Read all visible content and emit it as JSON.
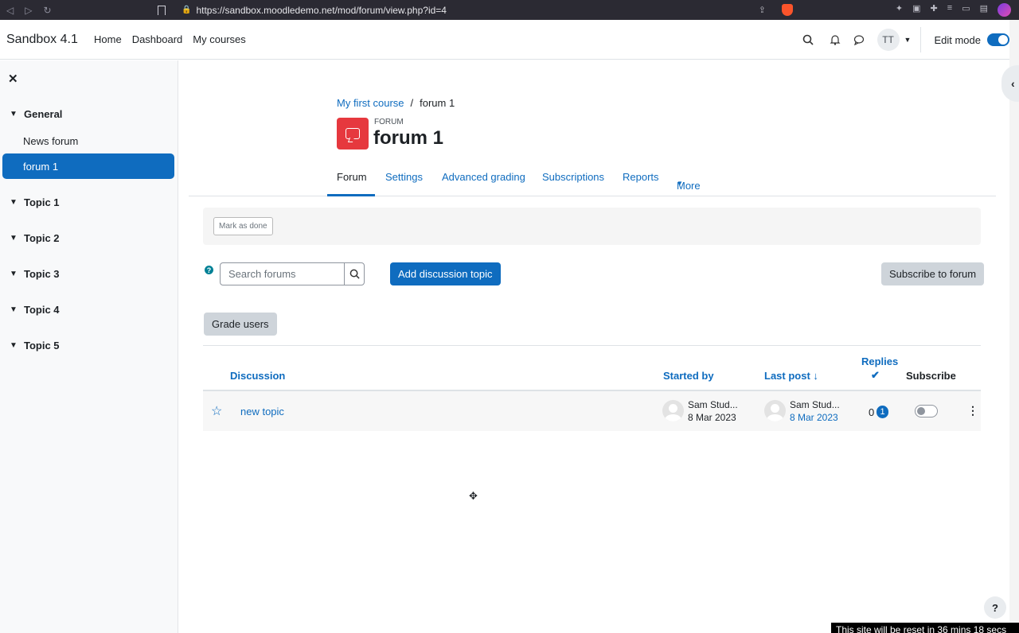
{
  "browser": {
    "url": "https://sandbox.moodledemo.net/mod/forum/view.php?id=4"
  },
  "navbar": {
    "brand": "Sandbox 4.1",
    "links": [
      "Home",
      "Dashboard",
      "My courses"
    ],
    "user_initials": "TT",
    "edit_mode_label": "Edit mode",
    "edit_mode_on": true
  },
  "drawer": {
    "sections": [
      {
        "label": "General",
        "activities": [
          "News forum",
          "forum 1"
        ]
      },
      {
        "label": "Topic 1"
      },
      {
        "label": "Topic 2"
      },
      {
        "label": "Topic 3"
      },
      {
        "label": "Topic 4"
      },
      {
        "label": "Topic 5"
      }
    ],
    "active_activity": "forum 1"
  },
  "breadcrumb": {
    "course": "My first course",
    "separator": "/",
    "current": "forum 1"
  },
  "header": {
    "kicker": "FORUM",
    "title": "forum 1"
  },
  "secondary_nav": {
    "tabs": [
      "Forum",
      "Settings",
      "Advanced grading",
      "Subscriptions",
      "Reports",
      "More"
    ],
    "active": "Forum"
  },
  "completion": {
    "mark_done_label": "Mark as done"
  },
  "actions": {
    "search_placeholder": "Search forums",
    "add_topic_label": "Add discussion topic",
    "subscribe_label": "Subscribe to forum",
    "grade_users_label": "Grade users"
  },
  "table": {
    "headers": {
      "discussion": "Discussion",
      "started_by": "Started by",
      "last_post": "Last post",
      "replies": "Replies",
      "subscribe": "Subscribe"
    },
    "rows": [
      {
        "topic": "new topic",
        "starter_name": "Sam Stud...",
        "starter_date": "8 Mar 2023",
        "last_name": "Sam Stud...",
        "last_date": "8 Mar 2023",
        "replies": "0",
        "unread": "1",
        "subscribed": false
      }
    ]
  },
  "footer": {
    "help": "?",
    "reset_notice": "This site will be reset in 36 mins 18 secs"
  },
  "colors": {
    "primary": "#0f6cbf",
    "forum_icon": "#e6383e",
    "secondary_button": "#ced4da"
  }
}
